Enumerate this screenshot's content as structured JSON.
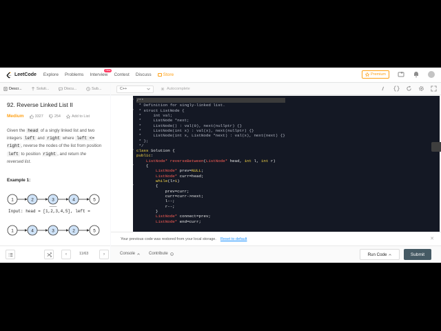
{
  "nav": {
    "logo_text": "LeetCode",
    "links": [
      "Explore",
      "Problems",
      "Interview",
      "Contest",
      "Discuss"
    ],
    "new_badge": "New",
    "store": "Store",
    "premium": "Premium"
  },
  "left_tabs": [
    "Descr...",
    "Soluti...",
    "Discu...",
    "Sub..."
  ],
  "editor_header": {
    "language": "C++",
    "autocomplete": "Autocomplete"
  },
  "problem": {
    "title": "92. Reverse Linked List II",
    "difficulty": "Medium",
    "likes": "3327",
    "dislikes": "254",
    "add_to_list": "Add to List",
    "body": {
      "p1": "Given the ",
      "c1": "head",
      "p2": " of a singly linked list and two integers ",
      "c2": "left",
      "p3": " and ",
      "c3": "right",
      "p4": " where ",
      "c4": "left <= right",
      "p5": ", reverse the nodes of the list from position ",
      "c5": "left",
      "p6": " to position ",
      "c6": "right",
      "p7": ", and return ",
      "p8": "the reversed list",
      "p9": "."
    },
    "example_title": "Example 1:",
    "diagram_row1": [
      "1",
      "2",
      "3",
      "4",
      "5"
    ],
    "diagram_row2": [
      "1",
      "4",
      "3",
      "2",
      "5"
    ],
    "example_input": "Input: head = [1,2,3,4,5], left ="
  },
  "code_lines": [
    [
      [
        "cm",
        "/**"
      ]
    ],
    [
      [
        "cm",
        " * Definition for singly-linked list."
      ]
    ],
    [
      [
        "cm",
        " * struct ListNode {"
      ]
    ],
    [
      [
        "cm",
        " *     int val;"
      ]
    ],
    [
      [
        "cm",
        " *     ListNode *next;"
      ]
    ],
    [
      [
        "cm",
        " *     ListNode() : val(0), next(nullptr) {}"
      ]
    ],
    [
      [
        "cm",
        " *     ListNode(int x) : val(x), next(nullptr) {}"
      ]
    ],
    [
      [
        "cm",
        " *     ListNode(int x, ListNode *next) : val(x), next(next) {}"
      ]
    ],
    [
      [
        "cm",
        " * };"
      ]
    ],
    [
      [
        "cm",
        " */"
      ]
    ],
    [
      [
        "kw",
        "class"
      ],
      [
        "tx",
        " Solution {"
      ]
    ],
    [
      [
        "kw",
        "public"
      ],
      [
        "tx",
        ":"
      ]
    ],
    [
      [
        "tx",
        "    "
      ],
      [
        "ty",
        "ListNode*"
      ],
      [
        "tx",
        " "
      ],
      [
        "ty",
        "reverseBetween"
      ],
      [
        "tx",
        "("
      ],
      [
        "ty",
        "ListNode*"
      ],
      [
        "tx",
        " head, "
      ],
      [
        "kw",
        "int"
      ],
      [
        "tx",
        " l, "
      ],
      [
        "kw",
        "int"
      ],
      [
        "tx",
        " r)"
      ]
    ],
    [
      [
        "tx",
        "    {"
      ]
    ],
    [
      [
        "tx",
        "        "
      ],
      [
        "ty",
        "ListNode*"
      ],
      [
        "tx",
        " prev="
      ],
      [
        "kw",
        "NULL"
      ],
      [
        "tx",
        ";"
      ]
    ],
    [
      [
        "tx",
        "        "
      ],
      [
        "ty",
        "ListNode*"
      ],
      [
        "tx",
        " curr=head;"
      ]
    ],
    [
      [
        "tx",
        "        "
      ],
      [
        "kw",
        "while"
      ],
      [
        "tx",
        "(l>"
      ],
      [
        "nu",
        "1"
      ],
      [
        "tx",
        ")"
      ]
    ],
    [
      [
        "tx",
        "        {"
      ]
    ],
    [
      [
        "tx",
        "            prev=curr;"
      ]
    ],
    [
      [
        "tx",
        "            curr=curr->next;"
      ]
    ],
    [
      [
        "tx",
        "            l--;"
      ]
    ],
    [
      [
        "tx",
        "            r--;"
      ]
    ],
    [
      [
        "tx",
        "        }"
      ]
    ],
    [
      [
        "tx",
        "        "
      ],
      [
        "ty",
        "ListNode*"
      ],
      [
        "tx",
        " connect=prev;"
      ]
    ],
    [
      [
        "tx",
        "        "
      ],
      [
        "ty",
        "ListNode*"
      ],
      [
        "tx",
        " end=curr;"
      ]
    ]
  ],
  "fold_lines": [
    1,
    3,
    11,
    14,
    18
  ],
  "notice": {
    "text": "Your previous code was restored from your local storage.",
    "reset": "Reset to default"
  },
  "bottom": {
    "pager": "11/63",
    "console": "Console",
    "contribute": "Contribute",
    "run": "Run Code",
    "submit": "Submit"
  },
  "colors": {
    "accent": "#ffa116",
    "editor_bg": "#141824",
    "submit_bg": "#455a64",
    "link": "#1890ff"
  }
}
